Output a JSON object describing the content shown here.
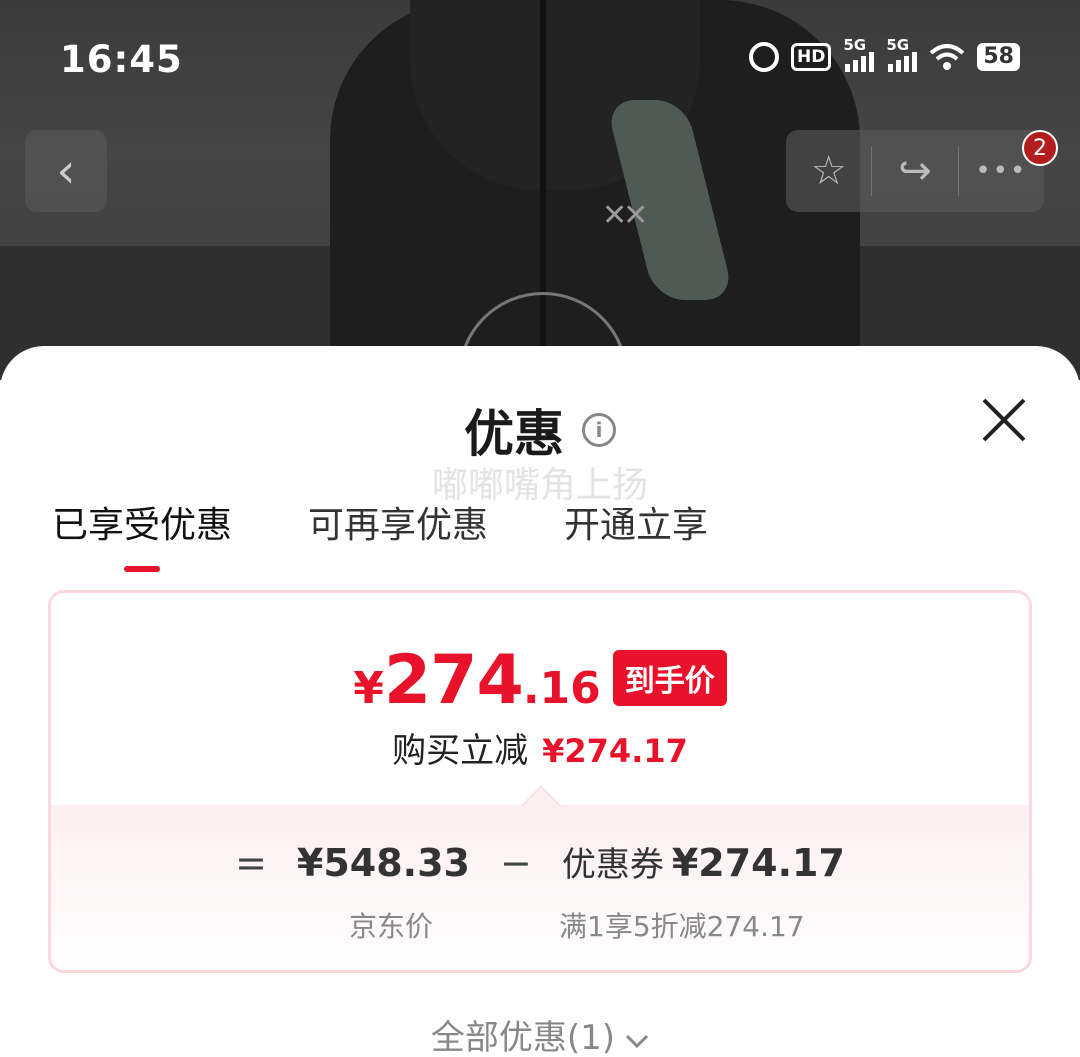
{
  "status_bar": {
    "time": "16:45",
    "hd_label": "HD",
    "signal1_label": "5G",
    "signal2_label": "5G",
    "battery": "58"
  },
  "nav": {
    "back_icon": "‹",
    "favorite_icon": "☆",
    "share_icon": "↪",
    "more_icon": "•••",
    "badge": "2"
  },
  "sheet": {
    "title": "优惠",
    "info_icon": "i",
    "close_icon": "✕",
    "watermark": "嘟嘟嘴角上扬",
    "tabs": [
      {
        "label": "已享受优惠",
        "active": true
      },
      {
        "label": "可再享优惠",
        "active": false
      },
      {
        "label": "开通立享",
        "active": false
      }
    ],
    "card": {
      "currency": "¥",
      "price_int": "274",
      "price_dec": ".16",
      "price_tag": "到手价",
      "discount_label": "购买立减",
      "discount_amount": "¥274.17",
      "equals": "=",
      "jd_price": "¥548.33",
      "minus": "−",
      "coupon_label": "优惠券",
      "coupon_amount": "¥274.17",
      "jd_price_label": "京东价",
      "coupon_desc": "满1享5折减274.17"
    },
    "all_offers": "全部优惠(1)",
    "all_offers_icon": "⌄"
  },
  "colors": {
    "accent": "#e8132a",
    "card_border": "#fbd8de",
    "card_bottom_bg": "#fdeef0"
  }
}
